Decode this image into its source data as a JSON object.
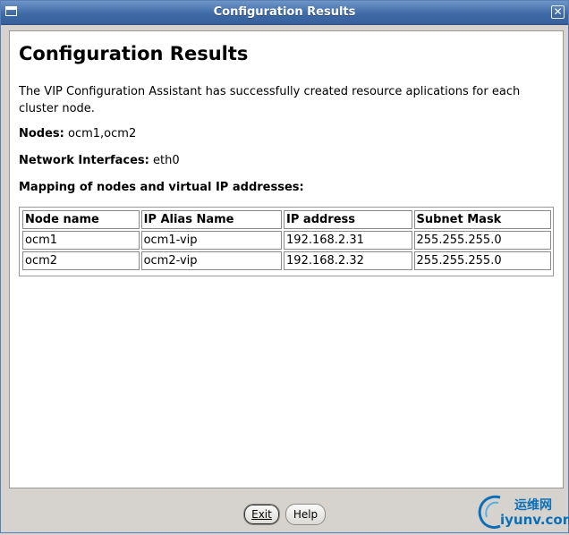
{
  "window": {
    "title": "Configuration Results",
    "close_glyph": "✕"
  },
  "content": {
    "heading": "Configuration Results",
    "description": "The VIP Configuration Assistant has successfully created resource aplications for each cluster node.",
    "nodes_label": "Nodes:",
    "nodes_value": "ocm1,ocm2",
    "interfaces_label": "Network Interfaces:",
    "interfaces_value": "eth0",
    "mapping_title": "Mapping of nodes and virtual IP addresses:"
  },
  "table": {
    "headers": [
      "Node name",
      "IP Alias Name",
      "IP address",
      "Subnet Mask"
    ],
    "rows": [
      [
        "ocm1",
        "ocm1-vip",
        "192.168.2.31",
        "255.255.255.0"
      ],
      [
        "ocm2",
        "ocm2-vip",
        "192.168.2.32",
        "255.255.255.0"
      ]
    ]
  },
  "buttons": {
    "exit": "Exit",
    "help": "Help"
  },
  "watermark": {
    "line1": "运维网",
    "line2": "iyunv.com"
  },
  "colors": {
    "titlebar": "#3f6aa6",
    "dialog_bg": "#d6d3ce",
    "watermark": "#0b6fb8"
  }
}
